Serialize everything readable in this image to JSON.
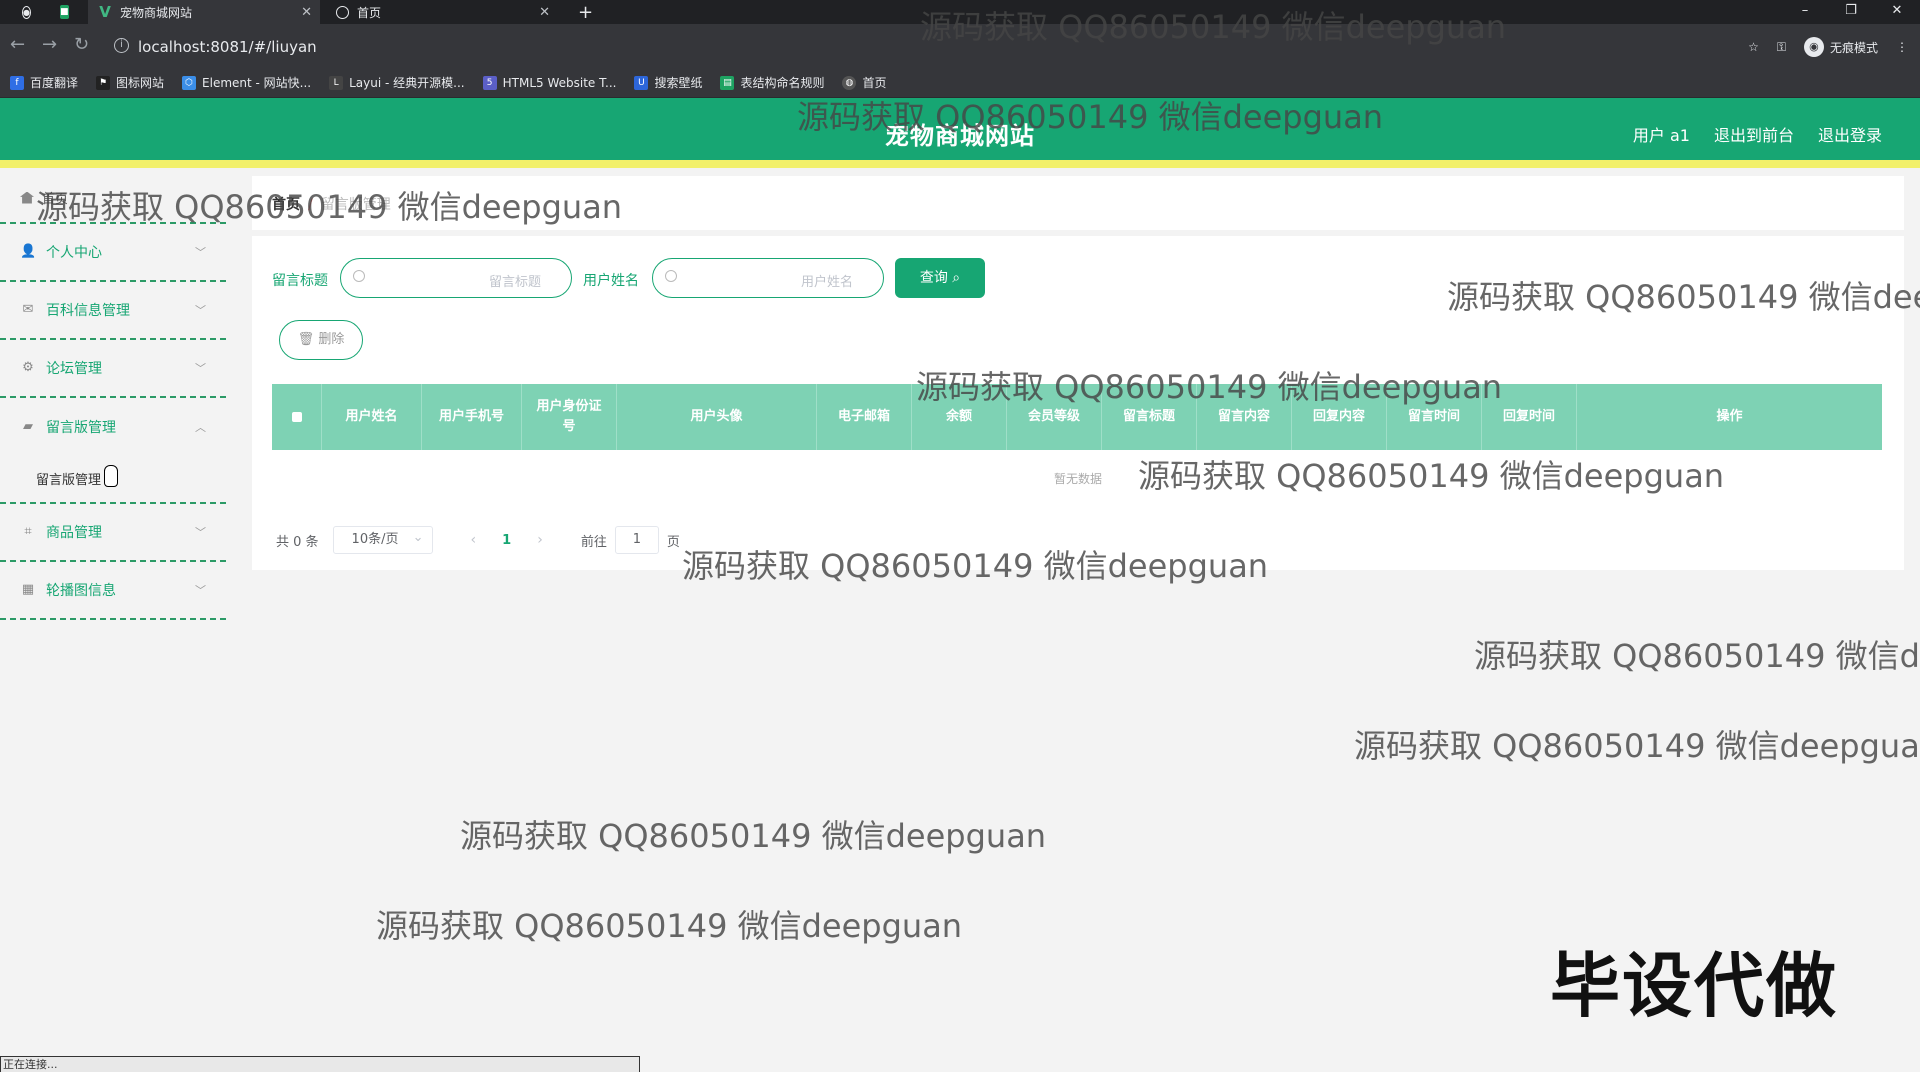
{
  "browser": {
    "tabs": [
      {
        "title": "宠物商城网站",
        "active": true
      },
      {
        "title": "首页",
        "active": false
      }
    ],
    "url": "localhost:8081/#/liuyan",
    "profile_label": "无痕模式",
    "bookmarks": [
      "百度翻译",
      "图标网站",
      "Element - 网站快...",
      "Layui - 经典开源模...",
      "HTML5 Website T...",
      "搜索壁纸",
      "表结构命名规则",
      "首页"
    ],
    "status_text": "正在连接..."
  },
  "header": {
    "title": "宠物商城网站",
    "user_label": "用户 a1",
    "back_label": "退出到前台",
    "logout_label": "退出登录"
  },
  "sidebar": {
    "home_label": "首页",
    "items": [
      {
        "label": "个人中心",
        "icon": "user-icon"
      },
      {
        "label": "百科信息管理",
        "icon": "mail-icon"
      },
      {
        "label": "论坛管理",
        "icon": "gear-icon"
      },
      {
        "label": "留言版管理",
        "icon": "folder-icon"
      },
      {
        "label": "商品管理",
        "icon": "crop-icon"
      },
      {
        "label": "轮播图信息",
        "icon": "grid-icon"
      }
    ],
    "submenu_label": "留言版管理"
  },
  "breadcrumb": {
    "home": "首页",
    "separator": "/",
    "current": "留言版管理"
  },
  "search": {
    "field1_label": "留言标题",
    "field1_placeholder": "留言标题",
    "field2_label": "用户姓名",
    "field2_placeholder": "用户姓名",
    "query_label": "查询"
  },
  "actions": {
    "delete_label": "删除"
  },
  "table": {
    "columns": [
      "用户姓名",
      "用户手机号",
      "用户身份证号",
      "用户头像",
      "电子邮箱",
      "余额",
      "会员等级",
      "留言标题",
      "留言内容",
      "回复内容",
      "留言时间",
      "回复时间",
      "操作"
    ],
    "empty_text": "暂无数据"
  },
  "pagination": {
    "total_label": "共 0 条",
    "page_size": "10条/页",
    "current_page": "1",
    "goto_label": "前往",
    "goto_value": "1",
    "page_suffix": "页"
  },
  "overlay": {
    "watermark": "源码获取 QQ86050149 微信deepguan",
    "stamp": "毕设代做"
  },
  "colors": {
    "primary": "#17a673",
    "header_bar": "#f2f06b",
    "table_head": "#7ed2b4"
  }
}
